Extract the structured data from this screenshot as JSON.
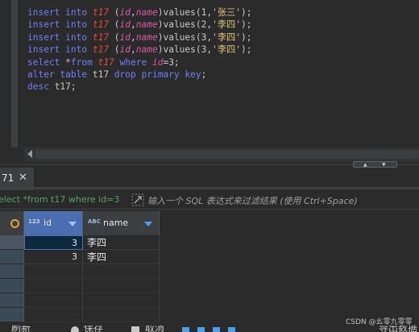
{
  "editor": {
    "lines": [
      [
        [
          "kw",
          "insert "
        ],
        [
          "kw",
          "into "
        ],
        [
          "tbl",
          "t17 "
        ],
        [
          "plain",
          "("
        ],
        [
          "col",
          "id"
        ],
        [
          "plain",
          ","
        ],
        [
          "col",
          "name"
        ],
        [
          "plain",
          ")values(1,'"
        ],
        [
          "str",
          "张三"
        ],
        [
          "plain",
          "');"
        ]
      ],
      [
        [
          "kw",
          "insert "
        ],
        [
          "kw",
          "into "
        ],
        [
          "tbl",
          "t17 "
        ],
        [
          "plain",
          "("
        ],
        [
          "col",
          "id"
        ],
        [
          "plain",
          ","
        ],
        [
          "col",
          "name"
        ],
        [
          "plain",
          ")values(2,'"
        ],
        [
          "str",
          "李四"
        ],
        [
          "plain",
          "');"
        ]
      ],
      [
        [
          "kw",
          "insert "
        ],
        [
          "kw",
          "into "
        ],
        [
          "tbl",
          "t17 "
        ],
        [
          "plain",
          "("
        ],
        [
          "col",
          "id"
        ],
        [
          "plain",
          ","
        ],
        [
          "col",
          "name"
        ],
        [
          "plain",
          ")values(3,'"
        ],
        [
          "str",
          "李四"
        ],
        [
          "plain",
          "');"
        ]
      ],
      [
        [
          "kw",
          "insert "
        ],
        [
          "kw",
          "into "
        ],
        [
          "tbl",
          "t17 "
        ],
        [
          "plain",
          "("
        ],
        [
          "col",
          "id"
        ],
        [
          "plain",
          ","
        ],
        [
          "col",
          "name"
        ],
        [
          "plain",
          ")values(3,'"
        ],
        [
          "str",
          "李四"
        ],
        [
          "plain",
          "');"
        ]
      ],
      [
        [
          "kw",
          "select "
        ],
        [
          "plain",
          "*"
        ],
        [
          "kw",
          "from "
        ],
        [
          "tbl",
          "t17 "
        ],
        [
          "kw",
          "where "
        ],
        [
          "col",
          "id"
        ],
        [
          "plain",
          "=3;"
        ]
      ],
      [
        [
          "kw",
          "alter "
        ],
        [
          "kw",
          "table "
        ],
        [
          "plain",
          "t17 "
        ],
        [
          "kw",
          "drop "
        ],
        [
          "kw",
          "primary "
        ],
        [
          "kw",
          "key"
        ],
        [
          "plain",
          ";"
        ]
      ],
      [
        [
          "kw",
          "desc "
        ],
        [
          "plain",
          "t17;"
        ]
      ]
    ]
  },
  "result_tab": {
    "label": "71",
    "close_icon": "close-icon"
  },
  "filter": {
    "query": "elect *from t17 where id=3",
    "placeholder": "输入一个 SQL 表达式来过滤结果 (使用 Ctrl+Space)"
  },
  "grid": {
    "columns": [
      {
        "badge": "123",
        "label": "id"
      },
      {
        "badge": "ABC",
        "label": "name"
      }
    ],
    "rows": [
      {
        "id": "3",
        "name": "李四"
      },
      {
        "id": "3",
        "name": "李四"
      }
    ]
  },
  "bottom_toolbar": {
    "items": [
      "刷新",
      "保存",
      "取消",
      "导出数据"
    ]
  },
  "watermark": "CSDN @幺零九零零",
  "colors": {
    "keyword": "#6f7ff4",
    "table": "#e7493a",
    "column": "#d55aa5",
    "string": "#e2c07b",
    "filter_query": "#58a05a",
    "selected_header": "#4b6eaf"
  }
}
